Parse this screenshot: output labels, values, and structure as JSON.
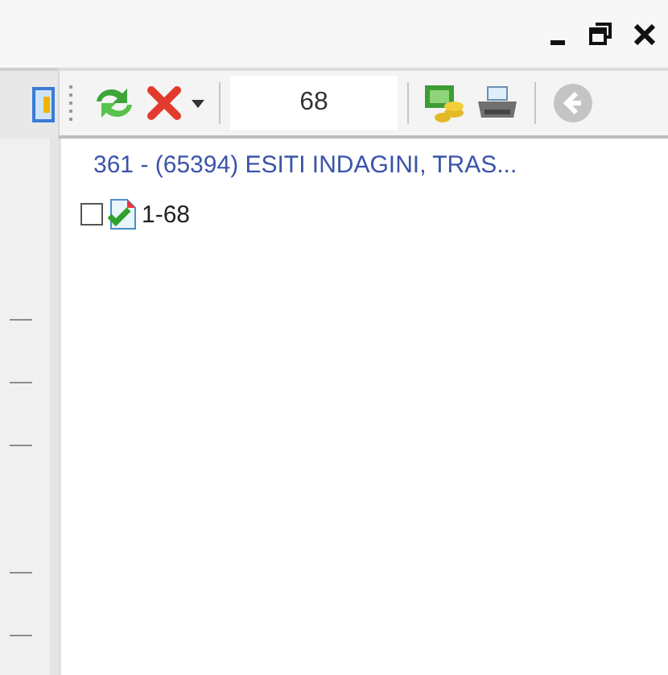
{
  "toolbar": {
    "page_field": {
      "value": "68"
    },
    "back_button": {
      "disabled": true
    }
  },
  "document": {
    "title": "361 - (65394) ESITI INDAGINI, TRAS...",
    "items": [
      {
        "label": "1-68",
        "checked": false
      }
    ]
  }
}
